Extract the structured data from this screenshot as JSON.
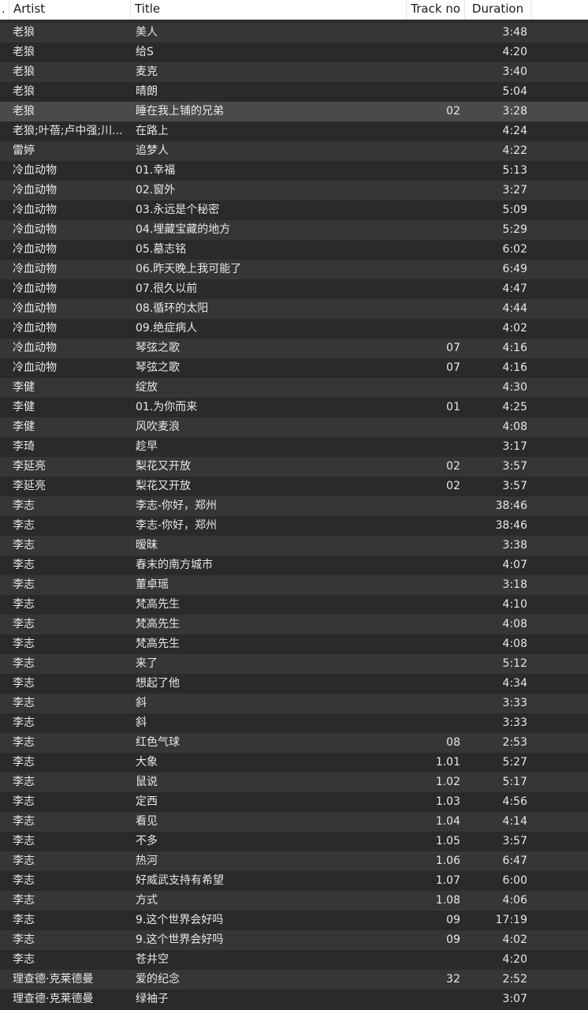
{
  "columns": {
    "dot": ".",
    "artist": "Artist",
    "title": "Title",
    "track": "Track no",
    "duration": "Duration"
  },
  "selected_index": 4,
  "rows": [
    {
      "artist": "老狼",
      "title": "美人",
      "track": "",
      "duration": "3:48"
    },
    {
      "artist": "老狼",
      "title": "给S",
      "track": "",
      "duration": "4:20"
    },
    {
      "artist": "老狼",
      "title": "麦克",
      "track": "",
      "duration": "3:40"
    },
    {
      "artist": "老狼",
      "title": "晴朗",
      "track": "",
      "duration": "5:04"
    },
    {
      "artist": "老狼",
      "title": "睡在我上铺的兄弟",
      "track": "02",
      "duration": "3:28"
    },
    {
      "artist": "老狼;叶蓓;卢中强;川...",
      "title": "在路上",
      "track": "",
      "duration": "4:24"
    },
    {
      "artist": "雷婷",
      "title": "追梦人",
      "track": "",
      "duration": "4:22"
    },
    {
      "artist": "冷血动物",
      "title": "01.幸福",
      "track": "",
      "duration": "5:13"
    },
    {
      "artist": "冷血动物",
      "title": "02.窗外",
      "track": "",
      "duration": "3:27"
    },
    {
      "artist": "冷血动物",
      "title": "03.永远是个秘密",
      "track": "",
      "duration": "5:09"
    },
    {
      "artist": "冷血动物",
      "title": "04.埋藏宝藏的地方",
      "track": "",
      "duration": "5:29"
    },
    {
      "artist": "冷血动物",
      "title": "05.墓志铭",
      "track": "",
      "duration": "6:02"
    },
    {
      "artist": "冷血动物",
      "title": "06.昨天晚上我可能了",
      "track": "",
      "duration": "6:49"
    },
    {
      "artist": "冷血动物",
      "title": "07.很久以前",
      "track": "",
      "duration": "4:47"
    },
    {
      "artist": "冷血动物",
      "title": "08.循环的太阳",
      "track": "",
      "duration": "4:44"
    },
    {
      "artist": "冷血动物",
      "title": "09.绝症病人",
      "track": "",
      "duration": "4:02"
    },
    {
      "artist": "冷血动物",
      "title": "琴弦之歌",
      "track": "07",
      "duration": "4:16"
    },
    {
      "artist": "冷血动物",
      "title": "琴弦之歌",
      "track": "07",
      "duration": "4:16"
    },
    {
      "artist": "李健",
      "title": "绽放",
      "track": "",
      "duration": "4:30"
    },
    {
      "artist": "李健",
      "title": "01.为你而来",
      "track": "01",
      "duration": "4:25"
    },
    {
      "artist": "李健",
      "title": "风吹麦浪",
      "track": "",
      "duration": "4:08"
    },
    {
      "artist": "李琦",
      "title": "趁早",
      "track": "",
      "duration": "3:17"
    },
    {
      "artist": "李延亮",
      "title": "梨花又开放",
      "track": "02",
      "duration": "3:57"
    },
    {
      "artist": "李延亮",
      "title": "梨花又开放",
      "track": "02",
      "duration": "3:57"
    },
    {
      "artist": "李志",
      "title": "李志-你好，郑州",
      "track": "",
      "duration": "38:46"
    },
    {
      "artist": "李志",
      "title": "李志-你好，郑州",
      "track": "",
      "duration": "38:46"
    },
    {
      "artist": "李志",
      "title": "暧昧",
      "track": "",
      "duration": "3:38"
    },
    {
      "artist": "李志",
      "title": "春末的南方城市",
      "track": "",
      "duration": "4:07"
    },
    {
      "artist": "李志",
      "title": "董卓瑶",
      "track": "",
      "duration": "3:18"
    },
    {
      "artist": "李志",
      "title": "梵高先生",
      "track": "",
      "duration": "4:10"
    },
    {
      "artist": "李志",
      "title": "梵高先生",
      "track": "",
      "duration": "4:08"
    },
    {
      "artist": "李志",
      "title": "梵高先生",
      "track": "",
      "duration": "4:08"
    },
    {
      "artist": "李志",
      "title": "来了",
      "track": "",
      "duration": "5:12"
    },
    {
      "artist": "李志",
      "title": "想起了他",
      "track": "",
      "duration": "4:34"
    },
    {
      "artist": "李志",
      "title": "斜",
      "track": "",
      "duration": "3:33"
    },
    {
      "artist": "李志",
      "title": "斜",
      "track": "",
      "duration": "3:33"
    },
    {
      "artist": "李志",
      "title": "红色气球",
      "track": "08",
      "duration": "2:53"
    },
    {
      "artist": "李志",
      "title": "大象",
      "track": "1.01",
      "duration": "5:27"
    },
    {
      "artist": "李志",
      "title": "鼠说",
      "track": "1.02",
      "duration": "5:17"
    },
    {
      "artist": "李志",
      "title": "定西",
      "track": "1.03",
      "duration": "4:56"
    },
    {
      "artist": "李志",
      "title": "看见",
      "track": "1.04",
      "duration": "4:14"
    },
    {
      "artist": "李志",
      "title": "不多",
      "track": "1.05",
      "duration": "3:57"
    },
    {
      "artist": "李志",
      "title": "热河",
      "track": "1.06",
      "duration": "6:47"
    },
    {
      "artist": "李志",
      "title": "好威武支持有希望",
      "track": "1.07",
      "duration": "6:00"
    },
    {
      "artist": "李志",
      "title": "方式",
      "track": "1.08",
      "duration": "4:06"
    },
    {
      "artist": "李志",
      "title": "9.这个世界会好吗",
      "track": "09",
      "duration": "17:19"
    },
    {
      "artist": "李志",
      "title": "9.这个世界会好吗",
      "track": "09",
      "duration": "4:02"
    },
    {
      "artist": "李志",
      "title": "苍井空",
      "track": "",
      "duration": "4:20"
    },
    {
      "artist": "理查德·克莱德曼",
      "title": "爱的纪念",
      "track": "32",
      "duration": "2:52"
    },
    {
      "artist": "理查德·克莱德曼",
      "title": "绿袖子",
      "track": "",
      "duration": "3:07"
    }
  ]
}
